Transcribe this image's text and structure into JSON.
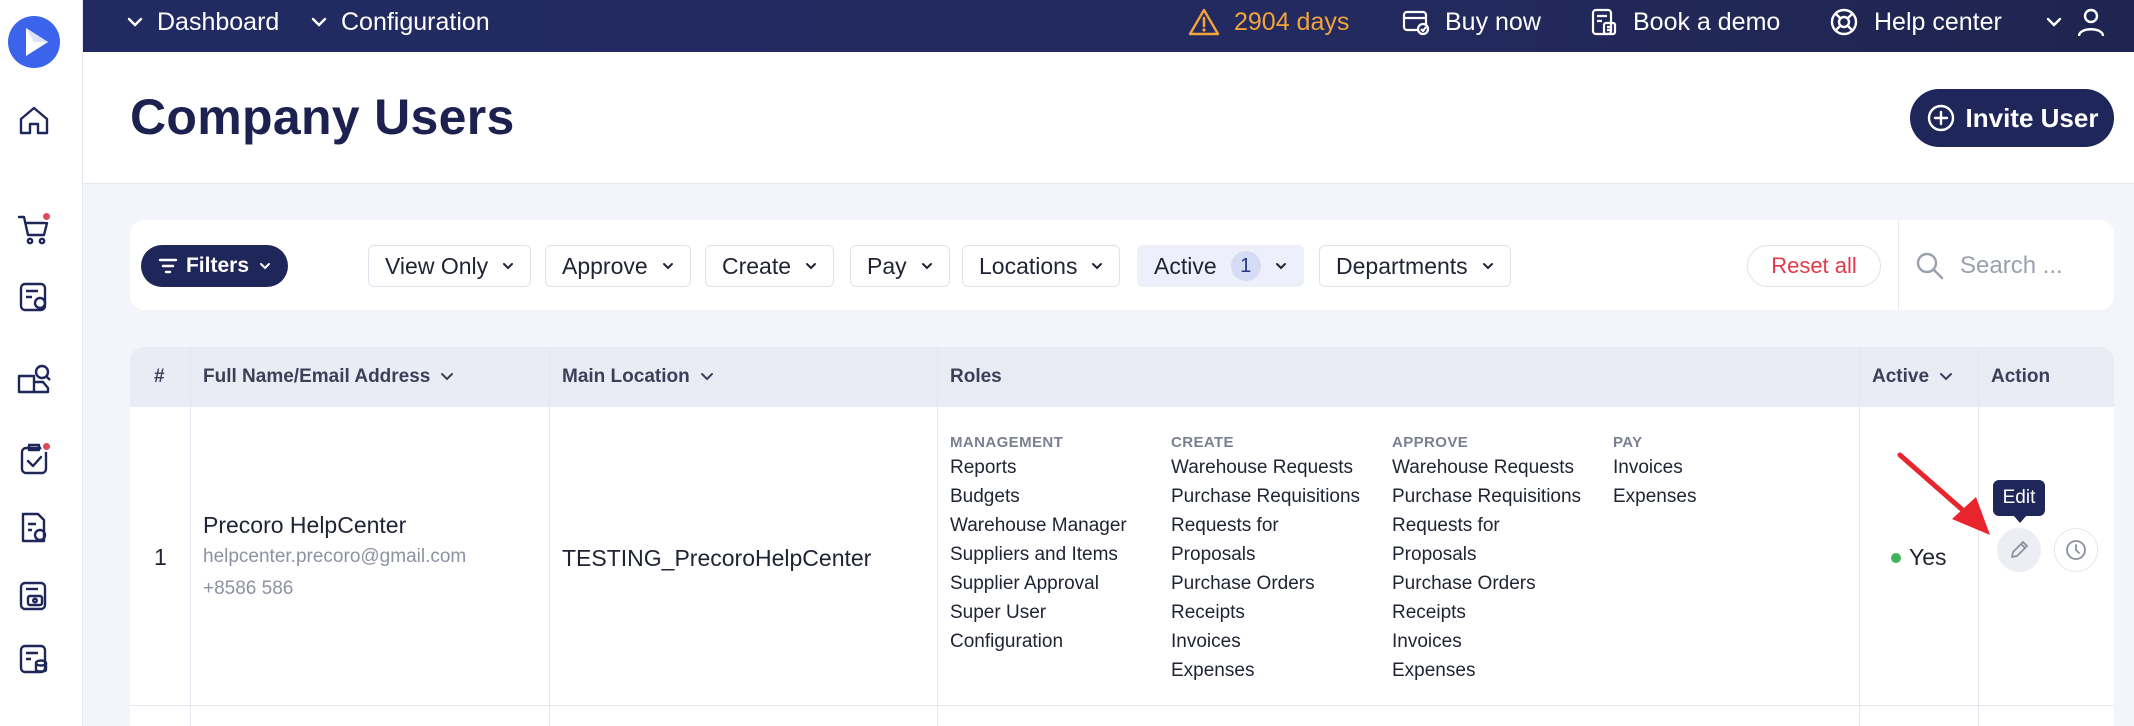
{
  "topbar": {
    "dashboard_label": "Dashboard",
    "configuration_label": "Configuration",
    "trial_days": "2904 days",
    "buy_now_label": "Buy now",
    "book_demo_label": "Book a demo",
    "help_center_label": "Help center"
  },
  "header": {
    "title": "Company Users",
    "invite_label": "Invite User"
  },
  "filters": {
    "filters_label": "Filters",
    "chips": [
      "View Only",
      "Approve",
      "Create",
      "Pay",
      "Locations",
      "Active",
      "Departments"
    ],
    "active_count": "1",
    "reset_label": "Reset all",
    "search_placeholder": "Search ..."
  },
  "table": {
    "columns": {
      "num": "#",
      "name": "Full Name/Email Address",
      "location": "Main Location",
      "roles": "Roles",
      "active": "Active",
      "action": "Action"
    },
    "rows": [
      {
        "num": "1",
        "name": "Precoro HelpCenter",
        "email": "helpcenter.precoro@gmail.com",
        "phone": "+8586 586",
        "location": "TESTING_PrecoroHelpCenter",
        "roles": {
          "management": {
            "head": "MANAGEMENT",
            "items": [
              "Reports",
              "Budgets",
              "Warehouse Manager",
              "Suppliers and Items",
              "Supplier Approval",
              "Super User",
              "Configuration"
            ]
          },
          "create": {
            "head": "CREATE",
            "items": [
              "Warehouse Requests",
              "Purchase Requisitions",
              "Requests for",
              "Proposals",
              "Purchase Orders",
              "Receipts",
              "Invoices",
              "Expenses"
            ]
          },
          "approve": {
            "head": "APPROVE",
            "items": [
              "Warehouse Requests",
              "Purchase Requisitions",
              "Requests for",
              "Proposals",
              "Purchase Orders",
              "Receipts",
              "Invoices",
              "Expenses"
            ]
          },
          "pay": {
            "head": "PAY",
            "items": [
              "Invoices",
              "Expenses"
            ]
          }
        },
        "active": "Yes",
        "edit_tooltip": "Edit"
      }
    ]
  },
  "colors": {
    "navy": "#1f2659",
    "warning": "#f2a33a",
    "reset_red": "#e0394a",
    "active_green": "#3fb35c",
    "notification_red": "#e2475a",
    "brand_blue": "#3b63ec"
  },
  "icons": {
    "sidebar": [
      "home-icon",
      "cart-icon",
      "requests-icon",
      "warehouse-icon",
      "approvals-icon",
      "invoices-icon",
      "payments-icon",
      "budgets-icon"
    ],
    "topbar": [
      "warning-icon",
      "buy-icon",
      "demo-icon",
      "lifebuoy-icon",
      "user-icon"
    ]
  }
}
